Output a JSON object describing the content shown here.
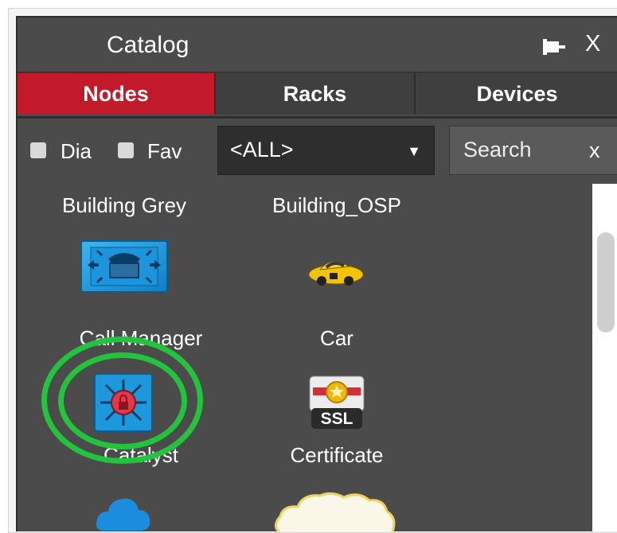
{
  "panel": {
    "title": "Catalog",
    "close_label": "X",
    "pin_icon": "pin-icon"
  },
  "tabs": [
    {
      "label": "Nodes",
      "active": true
    },
    {
      "label": "Racks",
      "active": false
    },
    {
      "label": "Devices",
      "active": false
    }
  ],
  "filters": {
    "dia_label": "Dia",
    "fav_label": "Fav",
    "select_value": "<ALL>",
    "search_placeholder": "Search",
    "search_clear": "x"
  },
  "items": [
    {
      "label": "Building Grey",
      "icon": "building-icon"
    },
    {
      "label": "Building_OSP",
      "icon": "building-icon"
    },
    {
      "label": "Call Manager",
      "icon": "call-manager-icon"
    },
    {
      "label": "Car",
      "icon": "car-icon"
    },
    {
      "label": "Catalyst",
      "icon": "catalyst-switch-icon"
    },
    {
      "label": "Certificate",
      "icon": "ssl-certificate-icon"
    },
    {
      "label": "",
      "icon": "cloud-icon"
    },
    {
      "label": "",
      "icon": "cloud-icon"
    }
  ],
  "colors": {
    "active_tab": "#c21a2b",
    "panel_bg": "#4b4b4b",
    "highlight": "#22c43d"
  }
}
